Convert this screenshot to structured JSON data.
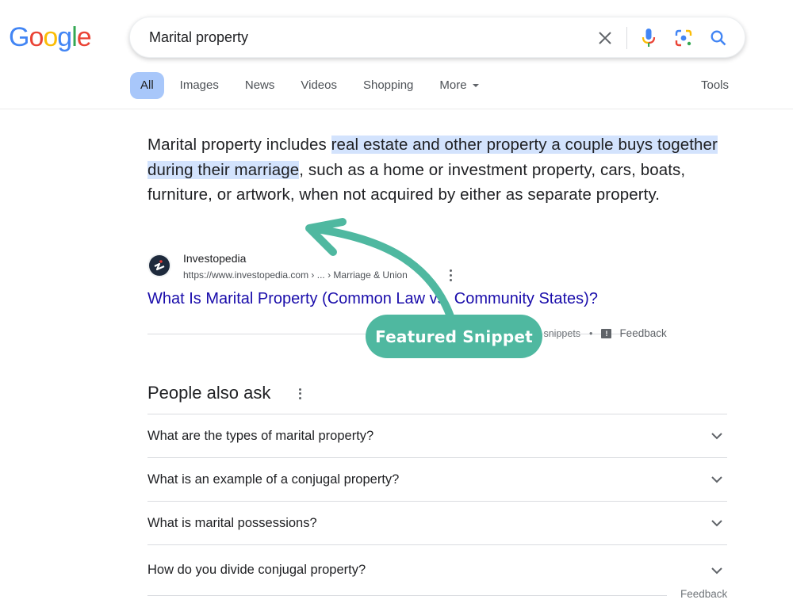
{
  "header": {
    "logo_letters": [
      {
        "char": "G",
        "color": "#4285f4"
      },
      {
        "char": "o",
        "color": "#ea4335"
      },
      {
        "char": "o",
        "color": "#fbbc05"
      },
      {
        "char": "g",
        "color": "#4285f4"
      },
      {
        "char": "l",
        "color": "#34a853"
      },
      {
        "char": "e",
        "color": "#ea4335"
      }
    ],
    "search_query": "Marital property",
    "icons": [
      "clear-icon",
      "microphone-icon",
      "google-lens-icon",
      "search-icon"
    ]
  },
  "tabs": [
    {
      "label": "All",
      "active": true
    },
    {
      "label": "Images",
      "active": false
    },
    {
      "label": "News",
      "active": false
    },
    {
      "label": "Videos",
      "active": false
    },
    {
      "label": "Shopping",
      "active": false
    },
    {
      "label": "More",
      "active": false
    }
  ],
  "tools_label": "Tools",
  "featured_snippet": {
    "text_before": "Marital property includes ",
    "text_highlight": "real estate and other property a couple buys together during their marriage",
    "text_after": ", such as a home or investment property, cars, boats, furniture, or artwork, when not acquired by either as separate property.",
    "source_name": "Investopedia",
    "source_url": "https://www.investopedia.com › ... › Marriage & Union",
    "result_title": "What Is Marital Property (Common Law vs. Community States)?",
    "about_link": "About featured snippets",
    "separator": "•",
    "feedback_label": "Feedback"
  },
  "people_also_ask": {
    "title": "People also ask",
    "questions": [
      "What are the types of marital property?",
      "What is an example of a conjugal property?",
      "What is marital possessions?",
      "How do you divide conjugal property?"
    ],
    "feedback_label": "Feedback"
  },
  "annotation": {
    "label": "Featured Snippet",
    "color": "#4fb8a0"
  }
}
